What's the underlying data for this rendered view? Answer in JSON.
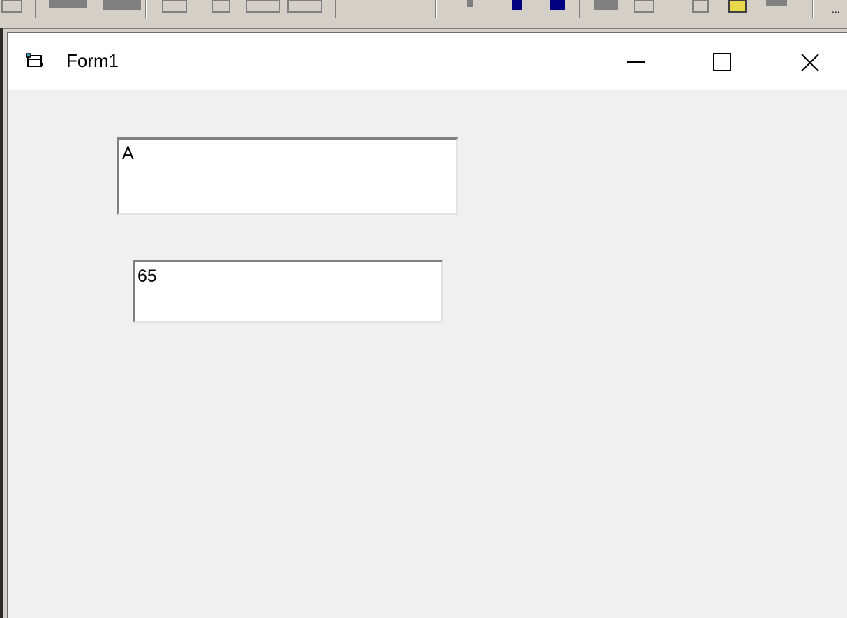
{
  "window": {
    "title": "Form1",
    "icon": "form-icon"
  },
  "caption_buttons": {
    "minimize_icon": "minimize-icon",
    "maximize_icon": "maximize-icon",
    "close_icon": "close-icon"
  },
  "fields": {
    "text1": {
      "value": "A"
    },
    "text2": {
      "value": "65"
    }
  },
  "ide_toolbar": {
    "overflow_label": "..."
  },
  "colors": {
    "form_background": "#f0f0f0",
    "titlebar_background": "#ffffff",
    "textbox_background": "#ffffff",
    "ide_background": "#d4d0c8"
  }
}
